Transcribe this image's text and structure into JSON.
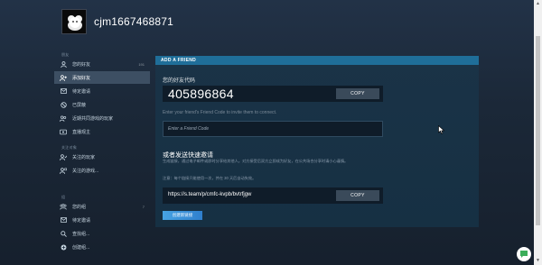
{
  "profile": {
    "username": "cjm1667468871"
  },
  "sidebar": {
    "friends_section_label": "朋友",
    "items": [
      {
        "label": "您的好友",
        "count": "191",
        "icon": "user-icon"
      },
      {
        "label": "添加好友",
        "count": "",
        "icon": "add-user-icon"
      },
      {
        "label": "待定邀请",
        "count": "",
        "icon": "envelope-icon"
      },
      {
        "label": "已屏蔽",
        "count": "",
        "icon": "blocked-icon"
      },
      {
        "label": "近期共同游戏的玩家",
        "count": "",
        "icon": "users-icon"
      },
      {
        "label": "直播观主",
        "count": "",
        "icon": "broadcast-icon"
      }
    ],
    "follow_section_label": "关注对象",
    "follow_items": [
      {
        "label": "关注的玩家",
        "icon": "follow-user-icon"
      },
      {
        "label": "关注的游戏...",
        "icon": "follow-game-icon"
      }
    ],
    "groups_section_label": "组",
    "group_items": [
      {
        "label": "您的组",
        "count": "7",
        "icon": "group-icon"
      },
      {
        "label": "待定邀请",
        "count": "",
        "icon": "envelope-icon"
      },
      {
        "label": "查找组...",
        "count": "",
        "icon": "search-icon"
      },
      {
        "label": "创建组...",
        "count": "",
        "icon": "plus-circle-icon"
      }
    ]
  },
  "panel": {
    "header": "ADD A FRIEND",
    "friend_code_label": "您的好友代码",
    "friend_code": "405896864",
    "copy_label": "COPY",
    "invite_hint": "Enter your friend's Friend Code to invite them to connect.",
    "code_input_placeholder": "Enter a Friend Code",
    "quick_invite_title": "或者发送快速邀请",
    "quick_invite_desc": "生成链接，通过电子邮件或即时分享给其他人。对方接受后双方立即成为好友，在公共场合分享时请小心谨慎。",
    "quick_invite_note": "注意：每个链接只能使用一次，并在 30 天后自动失效。",
    "invite_link": "https://s.team/p/cmfc-kvpb/bvtrfjgw",
    "new_link_label": "创建新链接"
  },
  "colors": {
    "accent": "#1f6e99",
    "button_blue": "#2f7fcd",
    "background": "#1b2838",
    "active_item": "#3d4f63"
  }
}
